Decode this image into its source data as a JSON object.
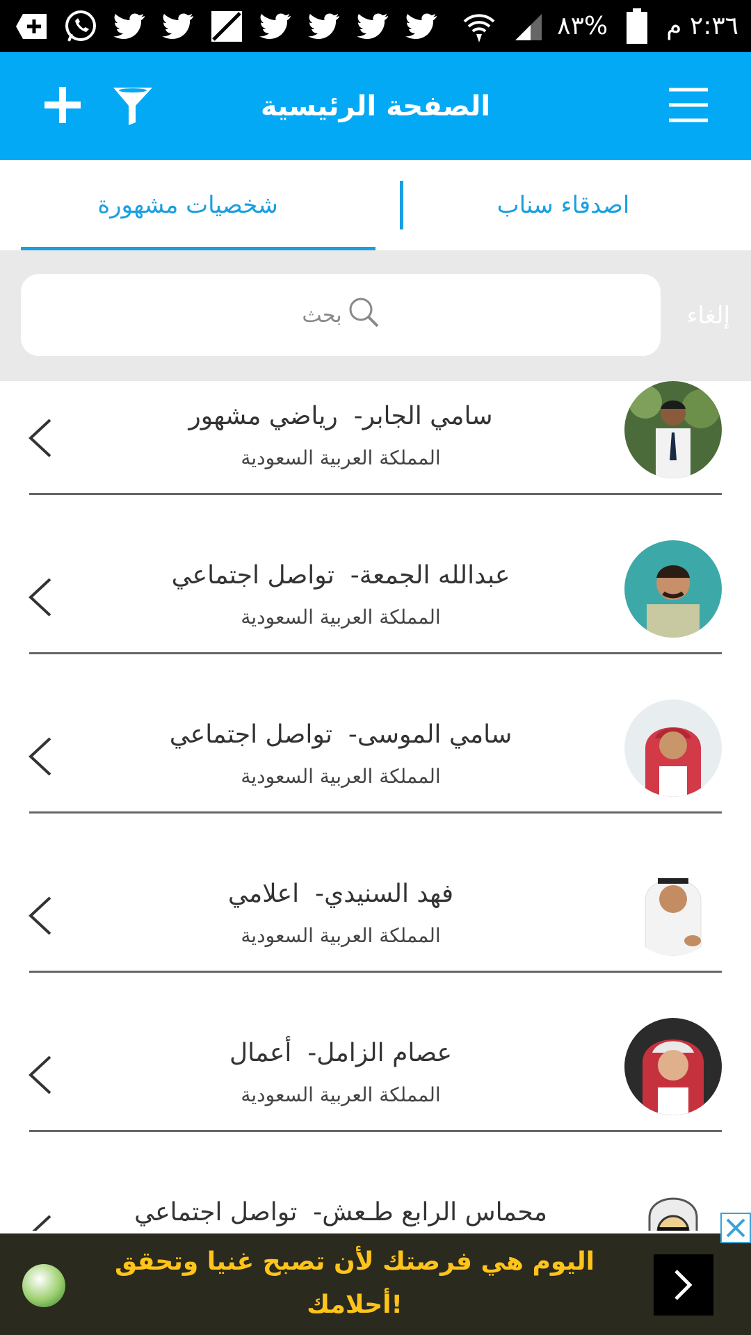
{
  "status_bar": {
    "time": "٢:٣٦ م",
    "battery": "٨٣%",
    "notification_icons": [
      "add-box-icon",
      "whatsapp-icon",
      "twitter-icon",
      "twitter-icon",
      "slash-box-icon",
      "twitter-icon",
      "twitter-icon",
      "twitter-icon",
      "twitter-icon"
    ]
  },
  "app_bar": {
    "title": "الصفحة الرئيسية",
    "icons": [
      "add-icon",
      "filter-icon",
      "menu-icon"
    ],
    "color": "#03a9f4"
  },
  "tabs": [
    {
      "label": "اصدقاء سناب",
      "active": false
    },
    {
      "label": "شخصيات مشهورة",
      "active": true
    }
  ],
  "search": {
    "placeholder": "بحث",
    "cancel_label": "إلغاء"
  },
  "list": [
    {
      "name": "سامي الجابر",
      "category": "رياضي مشهور",
      "country": "المملكة العربية السعودية"
    },
    {
      "name": "عبدالله الجمعة",
      "category": "تواصل اجتماعي",
      "country": "المملكة العربية السعودية"
    },
    {
      "name": "سامي الموسى",
      "category": "تواصل اجتماعي",
      "country": "المملكة العربية السعودية"
    },
    {
      "name": "فهد السنيدي",
      "category": "اعلامي",
      "country": "المملكة العربية السعودية"
    },
    {
      "name": "عصام الزامل",
      "category": "أعمال",
      "country": "المملكة العربية السعودية"
    },
    {
      "name": "محماس الرابع طـعش",
      "category": "تواصل اجتماعي",
      "country": ""
    }
  ],
  "ad": {
    "text": "اليوم هي فرصتك لأن تصبح غنيا وتحقق أحلامك!"
  }
}
